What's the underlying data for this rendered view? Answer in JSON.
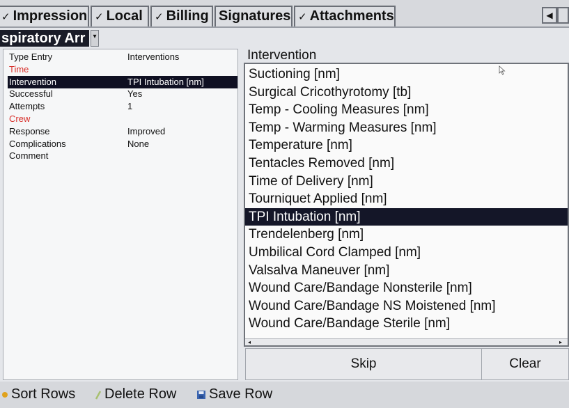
{
  "tabs": [
    {
      "label": "Impression",
      "checked": true
    },
    {
      "label": "Local",
      "checked": true
    },
    {
      "label": "Billing",
      "checked": true
    },
    {
      "label": "Signatures",
      "checked": false
    },
    {
      "label": "Attachments",
      "checked": true
    }
  ],
  "check_glyph": "✓",
  "tab_scroll_left": "◀",
  "selector": {
    "value": "spiratory Arr",
    "drop_glyph": "▾"
  },
  "properties": [
    {
      "key": "Type Entry",
      "value": "Interventions",
      "required": false,
      "selected": false
    },
    {
      "key": "Time",
      "value": "",
      "required": true,
      "selected": false
    },
    {
      "key": "Intervention",
      "value": "TPI Intubation [nm]",
      "required": false,
      "selected": true
    },
    {
      "key": "Successful",
      "value": "Yes",
      "required": false,
      "selected": false
    },
    {
      "key": "Attempts",
      "value": "1",
      "required": false,
      "selected": false
    },
    {
      "key": "Crew",
      "value": "",
      "required": true,
      "selected": false
    },
    {
      "key": "Response",
      "value": "Improved",
      "required": false,
      "selected": false
    },
    {
      "key": "Complications",
      "value": "None",
      "required": false,
      "selected": false
    },
    {
      "key": "Comment",
      "value": "",
      "required": false,
      "selected": false
    }
  ],
  "list": {
    "heading": "Intervention",
    "items": [
      "Suctioning [nm]",
      "Surgical Cricothyrotomy [tb]",
      "Temp - Cooling Measures [nm]",
      "Temp - Warming Measures [nm]",
      "Temperature [nm]",
      "Tentacles Removed [nm]",
      "Time of Delivery [nm]",
      "Tourniquet Applied [nm]",
      "TPI Intubation [nm]",
      "Trendelenberg [nm]",
      "Umbilical Cord Clamped [nm]",
      "Valsalva Maneuver [nm]",
      "Wound Care/Bandage Nonsterile [nm]",
      "Wound Care/Bandage NS Moistened [nm]",
      "Wound Care/Bandage Sterile [nm]"
    ],
    "selected_index": 8
  },
  "buttons": {
    "skip": "Skip",
    "clear": "Clear"
  },
  "toolbar": {
    "sort": "Sort Rows",
    "delete": "Delete Row",
    "save": "Save Row"
  },
  "colors": {
    "selection": "#141628",
    "required_label": "#d8322d"
  }
}
